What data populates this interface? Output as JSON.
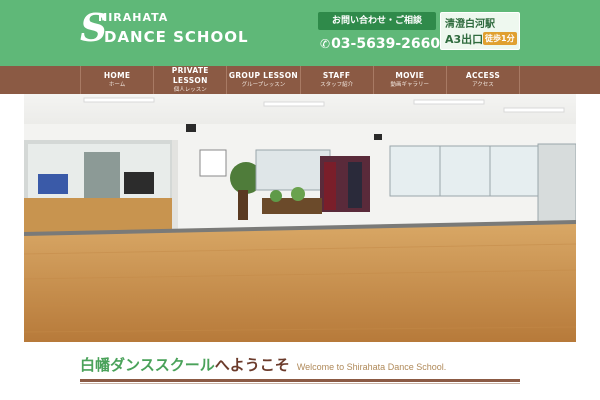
{
  "colors": {
    "header_green": "#5fb878",
    "nav_brown": "#8b5a44",
    "accent_dark_green": "#2f8a4a",
    "welcome_green": "#4aa25a",
    "welcome_brown": "#6b3a2a",
    "welcome_en": "#b08a5a"
  },
  "header": {
    "logo": {
      "initial": "S",
      "line1": "HIRAHATA",
      "line2": "DANCE SCHOOL"
    },
    "contact_label": "お問い合わせ・ご相談",
    "phone_icon": "phone-icon",
    "phone": "03-5639-2660",
    "station": {
      "name": "清澄白河駅",
      "exit": "A3出口",
      "walk": "徒歩1分"
    }
  },
  "nav": {
    "items": [
      {
        "en": "HOME",
        "jp": "ホーム"
      },
      {
        "en": "PRIVATE LESSON",
        "jp": "個人レッスン"
      },
      {
        "en": "GROUP LESSON",
        "jp": "グループレッスン"
      },
      {
        "en": "STAFF",
        "jp": "スタッフ紹介"
      },
      {
        "en": "MOVIE",
        "jp": "動画ギャラリー"
      },
      {
        "en": "ACCESS",
        "jp": "アクセス"
      }
    ]
  },
  "welcome": {
    "jp_name": "白幡ダンススクール",
    "jp_suffix": "へようこそ",
    "en": "Welcome to Shirahata Dance School."
  }
}
